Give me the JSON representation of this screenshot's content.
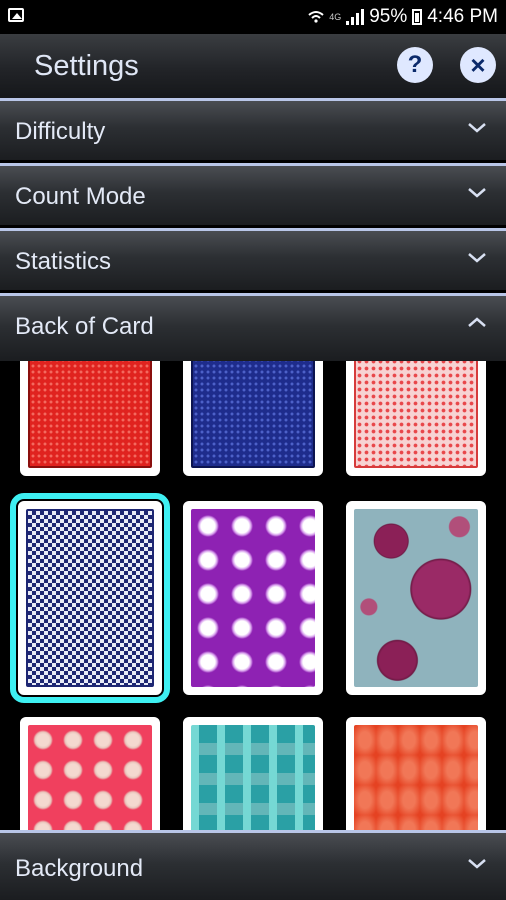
{
  "status_bar": {
    "network": "4G",
    "battery": "95%",
    "time": "4:46 PM",
    "icons": [
      "image-icon",
      "wifi-icon",
      "signal-icon",
      "battery-icon"
    ]
  },
  "header": {
    "title": "Settings",
    "help_icon": "?",
    "close_icon": "×"
  },
  "sections": [
    {
      "label": "Difficulty",
      "state": "collapsed"
    },
    {
      "label": "Count Mode",
      "state": "collapsed"
    },
    {
      "label": "Statistics",
      "state": "collapsed"
    },
    {
      "label": "Back of Card",
      "state": "expanded"
    },
    {
      "label": "Background",
      "state": "collapsed"
    }
  ],
  "card_backs": [
    {
      "name": "red-dots"
    },
    {
      "name": "blue-dots"
    },
    {
      "name": "pink-checker"
    },
    {
      "name": "navy-checker",
      "selected": true
    },
    {
      "name": "purple-flowers"
    },
    {
      "name": "plum-circles"
    },
    {
      "name": "pink-flowers"
    },
    {
      "name": "teal-blocks"
    },
    {
      "name": "orange-waves"
    }
  ],
  "colors": {
    "selection_outline": "#3ef0f2",
    "header_text": "#dfe6f5",
    "row_border": "#b9c6e8",
    "button_bg": "#dfe8ff",
    "button_fg": "#0b2a6b"
  }
}
